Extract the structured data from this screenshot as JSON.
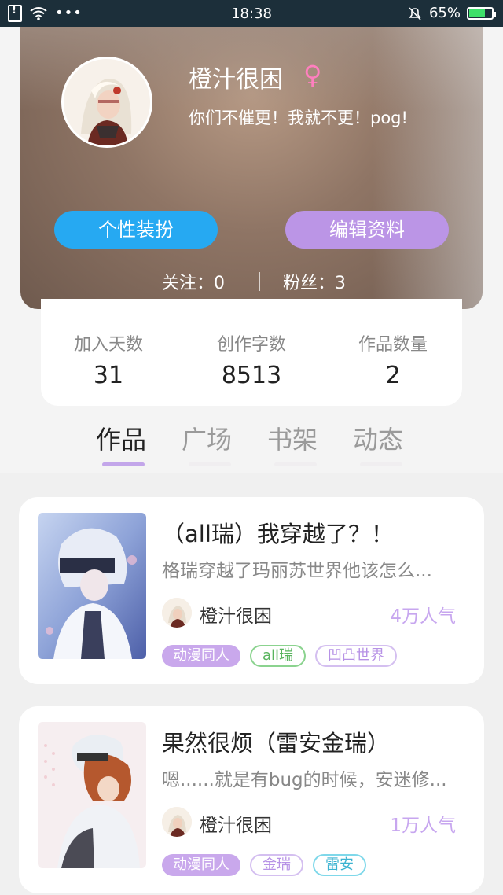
{
  "status_bar": {
    "time": "18:38",
    "battery": "65%",
    "battery_level": 0.65
  },
  "profile": {
    "username": "橙汁很困",
    "gender_symbol": "♀",
    "signature": "你们不催更！我就不更！pog!",
    "buttons": {
      "dress_up": "个性装扮",
      "edit_profile": "编辑资料"
    },
    "following": "关注：0",
    "fans": "粉丝：3"
  },
  "stats": [
    {
      "label": "加入天数",
      "value": "31"
    },
    {
      "label": "创作字数",
      "value": "8513"
    },
    {
      "label": "作品数量",
      "value": "2"
    }
  ],
  "tabs": [
    "作品",
    "广场",
    "书架",
    "动态"
  ],
  "active_tab": "作品",
  "works": [
    {
      "title": "（all瑞）我穿越了？！",
      "desc": "格瑞穿越了玛丽苏世界他该怎么...",
      "author": "橙汁很困",
      "popularity": "4万人气",
      "tags": [
        "动漫同人",
        "all瑞",
        "凹凸世界"
      ]
    },
    {
      "title": "果然很烦（雷安金瑞）",
      "desc": "嗯......就是有bug的时候，安迷修...",
      "author": "橙汁很困",
      "popularity": "1万人气",
      "tags": [
        "动漫同人",
        "金瑞",
        "雷安"
      ]
    }
  ],
  "colors": {
    "accent_blue": "#26a9f2",
    "accent_purple": "#bb95e6",
    "tab_indicator": "#c3a6ea"
  }
}
